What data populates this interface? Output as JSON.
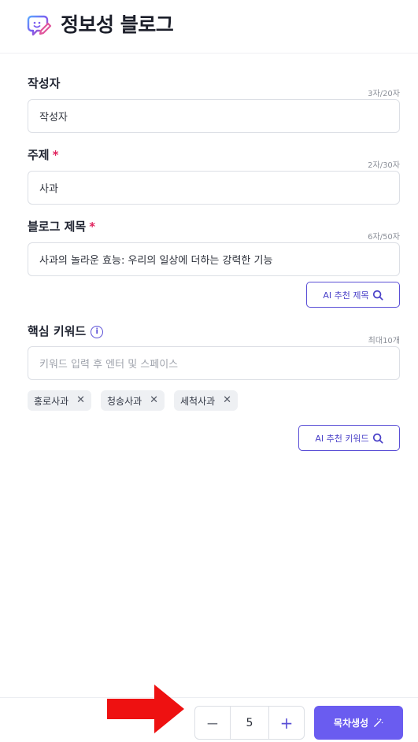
{
  "header": {
    "title": "정보성 블로그",
    "logo_icon": "chat-edit-icon"
  },
  "fields": {
    "author": {
      "label": "작성자",
      "counter": "3자/20자",
      "value": "작성자"
    },
    "topic": {
      "label": "주제",
      "required_mark": "*",
      "counter": "2자/30자",
      "value": "사과"
    },
    "blog_title": {
      "label": "블로그 제목",
      "required_mark": "*",
      "counter": "6자/50자",
      "value": "사과의 놀라운 효능: 우리의 일상에 더하는 강력한 기능",
      "ai_button": "AI 추천 제목"
    },
    "keywords": {
      "label": "핵심 키워드",
      "info_icon": "i",
      "counter": "최대10개",
      "placeholder": "키워드 입력 후 엔터 및 스페이스",
      "chips": [
        "홍로사과",
        "청송사과",
        "세척사과"
      ],
      "chip_remove": "✕",
      "ai_button": "AI 추천 키워드"
    }
  },
  "footer": {
    "stepper": {
      "minus": "−",
      "value": "5",
      "plus": "+"
    },
    "generate_button": "목차생성"
  },
  "colors": {
    "accent": "#6a5cf0",
    "required": "#e0245e",
    "arrow": "#ee1111"
  }
}
